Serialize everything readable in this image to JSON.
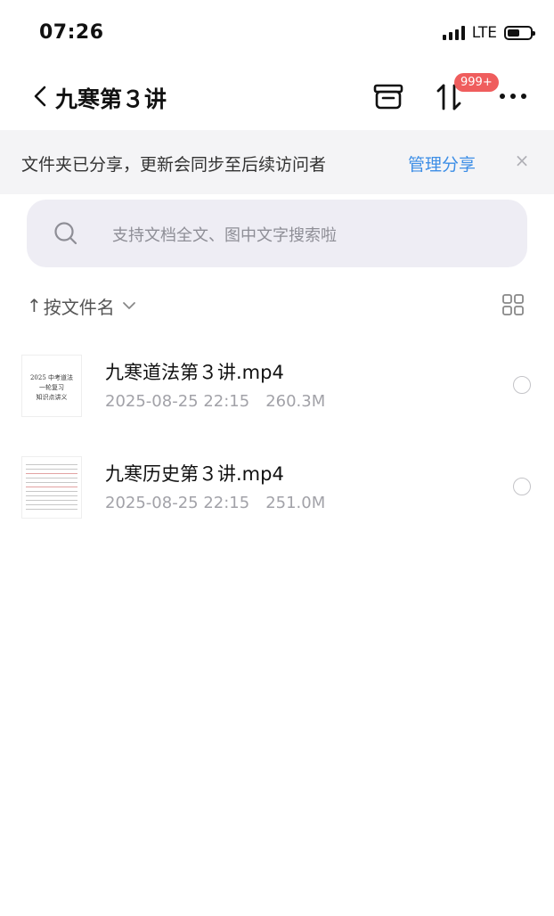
{
  "status_bar": {
    "time": "07:26",
    "network": "LTE"
  },
  "header": {
    "title": "九寒第３讲",
    "badge": "999+",
    "icons": [
      "back-chevron-icon",
      "package-icon",
      "transfer-arrows-icon",
      "more-dots-icon"
    ]
  },
  "banner": {
    "text": "文件夹已分享，更新会同步至后续访问者",
    "link": "管理分享",
    "close": "×"
  },
  "search": {
    "placeholder": "支持文档全文、图中文字搜索啦"
  },
  "sort": {
    "arrow": "↑",
    "label": "按文件名"
  },
  "files": [
    {
      "name": "九寒道法第３讲.mp4",
      "date": "2025-08-25 22:15",
      "size": "260.3M",
      "thumb_lines": [
        "2025 中考道法",
        "一轮复习",
        "知识点讲义"
      ]
    },
    {
      "name": "九寒历史第３讲.mp4",
      "date": "2025-08-25 22:15",
      "size": "251.0M"
    }
  ],
  "colors": {
    "accent": "#3d8ee6",
    "badge": "#ef5d5d",
    "banner_bg": "#f4f4f6",
    "search_bg": "#eeedf4"
  }
}
